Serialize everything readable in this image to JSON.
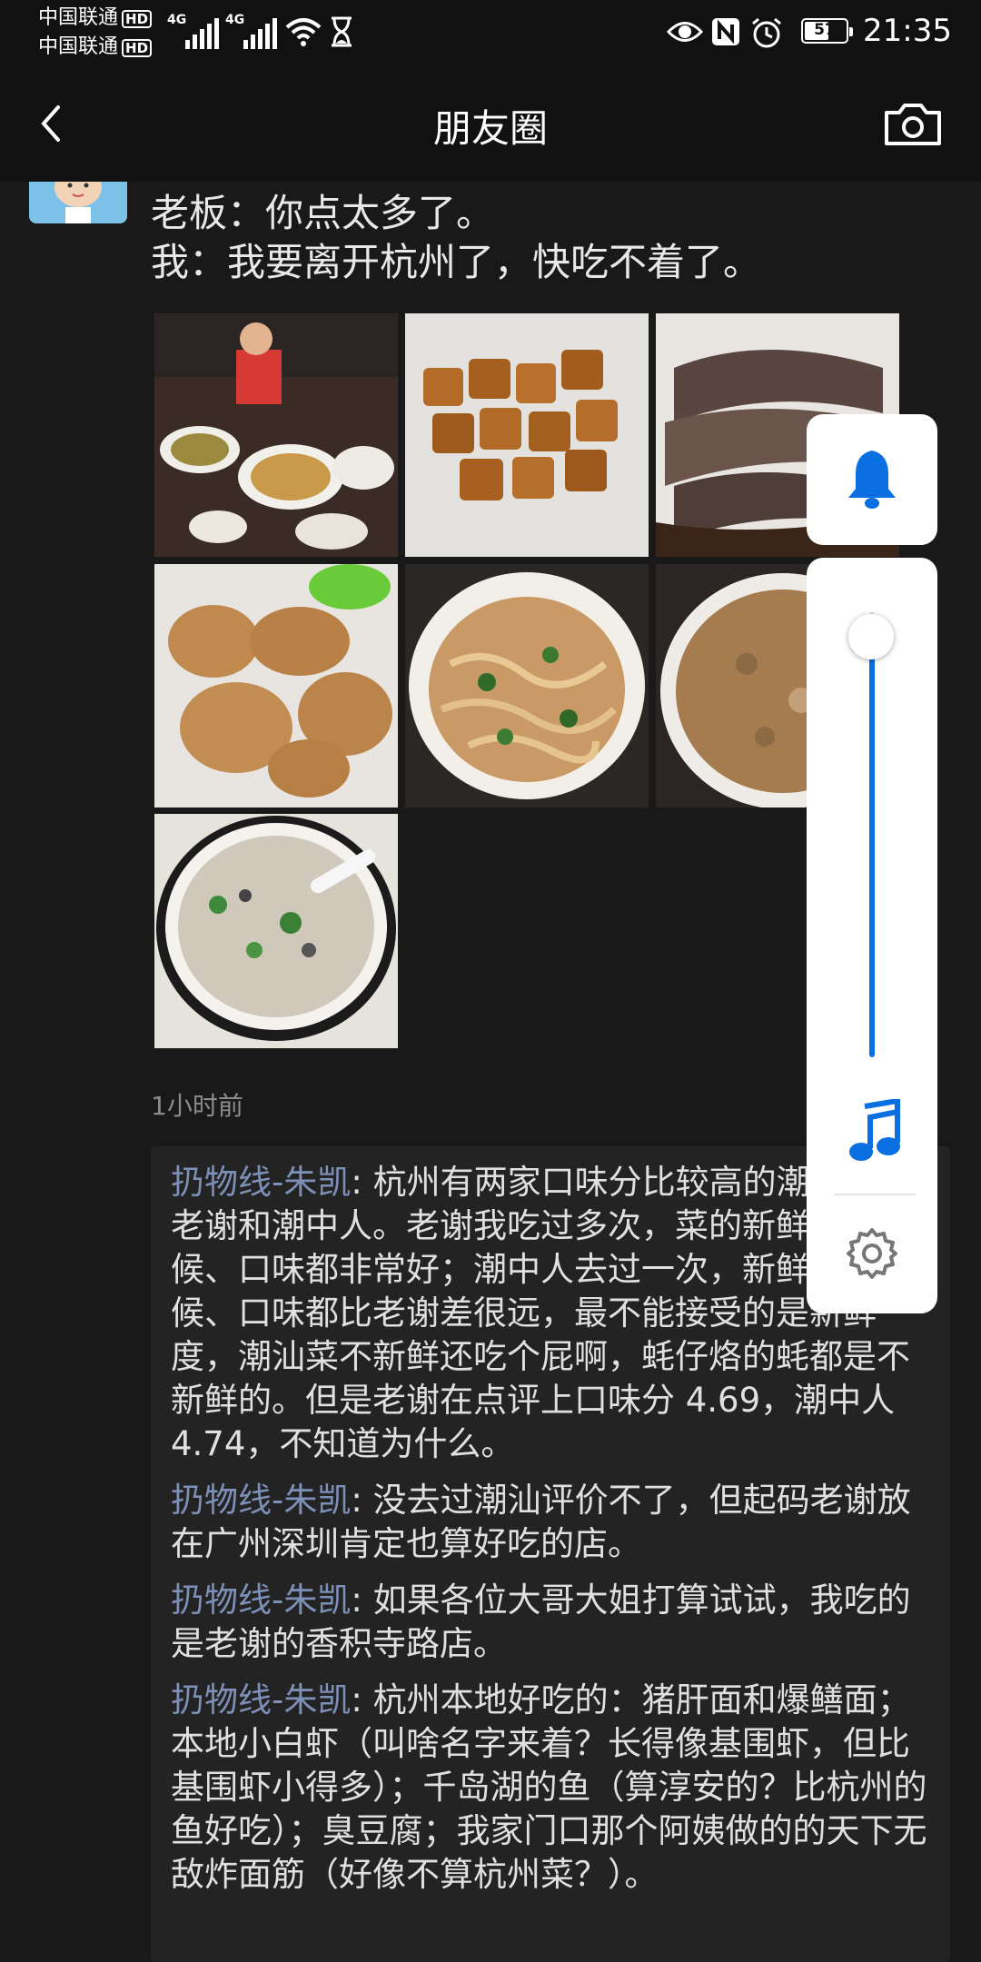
{
  "status_bar": {
    "carrier1": "中国联通",
    "carrier2": "中国联通",
    "hd": "HD",
    "net1": "4G",
    "net2": "4G",
    "battery": "57",
    "time": "21:35",
    "icons": [
      "wifi-icon",
      "hourglass-icon",
      "eye-icon",
      "nfc-icon",
      "alarm-icon",
      "battery-icon"
    ]
  },
  "nav": {
    "title": "朋友圈",
    "back_icon": "chevron-left-icon",
    "camera_icon": "camera-icon"
  },
  "post": {
    "text_lines": [
      "老板：你点太多了。",
      "我：我要离开杭州了，快吃不着了。"
    ],
    "time": "1小时前",
    "photo_count": 7
  },
  "comments": [
    {
      "author": "扔物线-朱凯",
      "sep": ": ",
      "text": "杭州有两家口味分比较高的潮汕菜：老谢和潮中人。老谢我吃过多次，菜的新鲜度、火候、口味都非常好；潮中人去过一次，新鲜度、火候、口味都比老谢差很远，最不能接受的是新鲜度，潮汕菜不新鲜还吃个屁啊，蚝仔烙的蚝都是不新鲜的。但是老谢在点评上口味分 4.69，潮中人 4.74，不知道为什么。"
    },
    {
      "author": "扔物线-朱凯",
      "sep": ": ",
      "text": "没去过潮汕评价不了，但起码老谢放在广州深圳肯定也算好吃的店。"
    },
    {
      "author": "扔物线-朱凯",
      "sep": ": ",
      "text": "如果各位大哥大姐打算试试，我吃的是老谢的香积寺路店。"
    },
    {
      "author": "扔物线-朱凯",
      "sep": ": ",
      "text": "杭州本地好吃的：猪肝面和爆鳝面；本地小白虾（叫啥名字来着？长得像基围虾，但比基围虾小得多）；千岛湖的鱼（算淳安的？比杭州的鱼好吃）；臭豆腐；我家门口那个阿姨做的的天下无敌炸面筋（好像不算杭州菜？）。"
    }
  ],
  "volume_panel": {
    "level": 0.93,
    "icons": [
      "bell-icon",
      "music-note-icon",
      "settings-icon"
    ],
    "accent": "#0a6fe0"
  }
}
